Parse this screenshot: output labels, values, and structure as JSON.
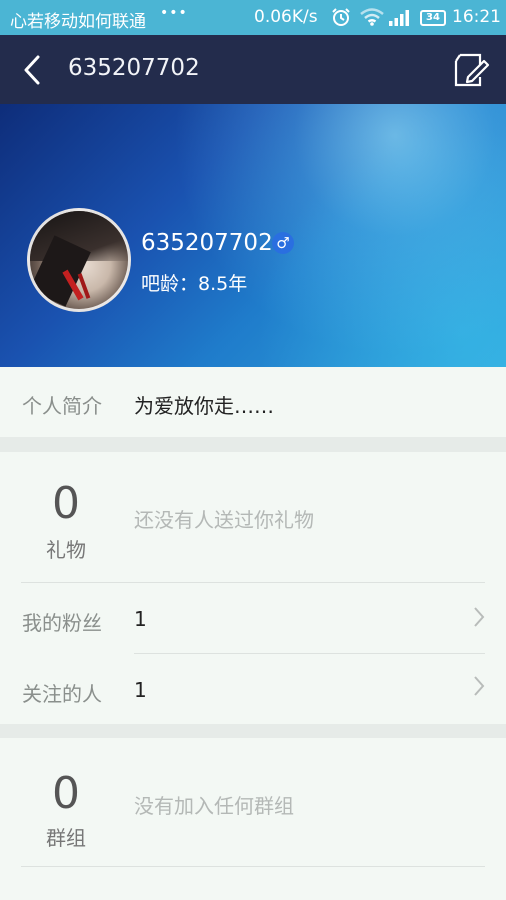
{
  "status_bar": {
    "carrier": "心若移动如何联通",
    "dots": "•••",
    "speed": "0.06K/s",
    "battery": "34",
    "time": "16:21"
  },
  "header": {
    "title": "635207702",
    "back_icon": "chevron-left-icon",
    "edit_icon": "edit-icon"
  },
  "profile": {
    "name": "635207702",
    "gender_symbol": "♂",
    "bar_age": "吧龄：8.5年"
  },
  "intro": {
    "label": "个人简介",
    "value": "为爱放你走……"
  },
  "gifts": {
    "count": "0",
    "label": "礼物",
    "empty_text": "还没有人送过你礼物"
  },
  "fans": {
    "label": "我的粉丝",
    "value": "1"
  },
  "following": {
    "label": "关注的人",
    "value": "1"
  },
  "groups": {
    "count": "0",
    "label": "群组",
    "empty_text": "没有加入任何群组"
  },
  "colors": {
    "status_bar": "#4bb5d4",
    "header": "#232c4c",
    "background": "#f3f8f4",
    "gender": "#2a6fe0"
  }
}
